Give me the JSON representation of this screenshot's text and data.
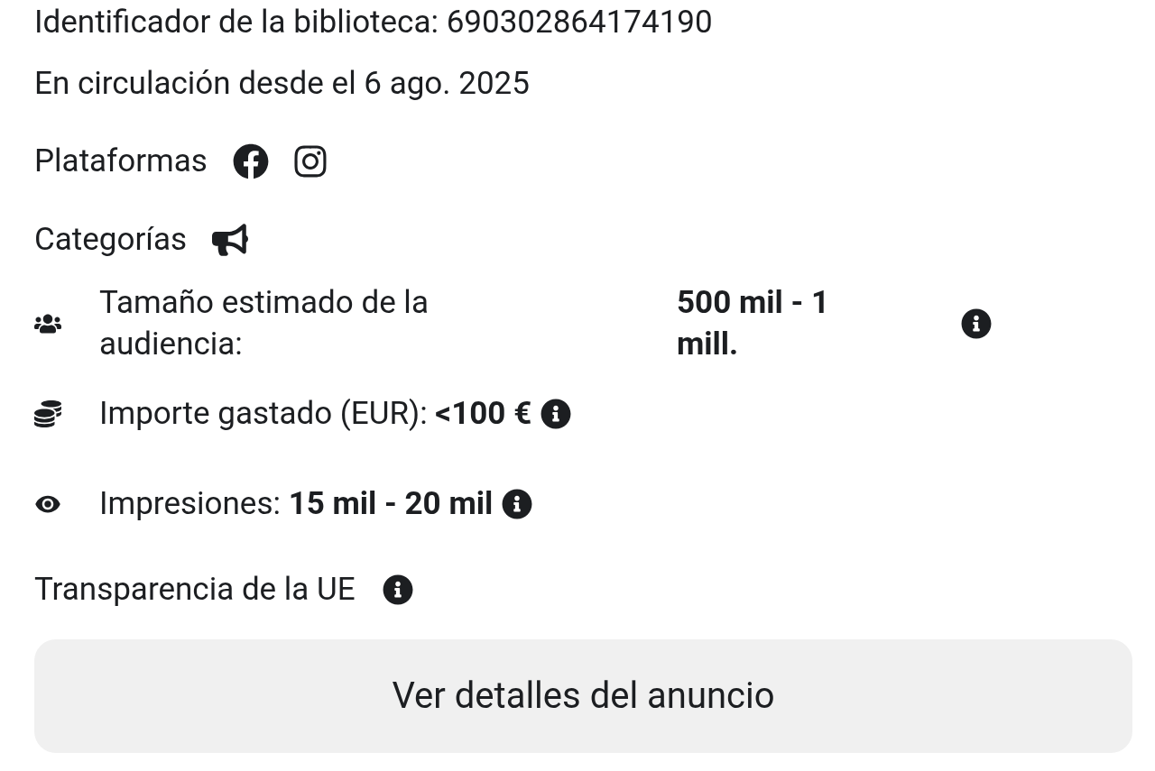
{
  "library_id": "Identificador de la biblioteca: 690302864174190",
  "active_since": "En circulación desde el 6 ago. 2025",
  "platforms": {
    "label": "Plataformas",
    "items": [
      {
        "kind": "facebook"
      },
      {
        "kind": "instagram"
      }
    ]
  },
  "categories": {
    "label": "Categorías",
    "items": [
      {
        "kind": "megaphone"
      }
    ]
  },
  "metrics": [
    {
      "kind": "audience",
      "label": "Tamaño estimado de la audiencia:",
      "value": "500 mil - 1 mill."
    },
    {
      "kind": "spend",
      "label": "Importe gastado (EUR):",
      "value": "<100 €"
    },
    {
      "kind": "impressions",
      "label": "Impresiones:",
      "value": "15 mil - 20 mil"
    }
  ],
  "eu_transparency": "Transparencia de la UE",
  "details_button": "Ver detalles del anuncio"
}
